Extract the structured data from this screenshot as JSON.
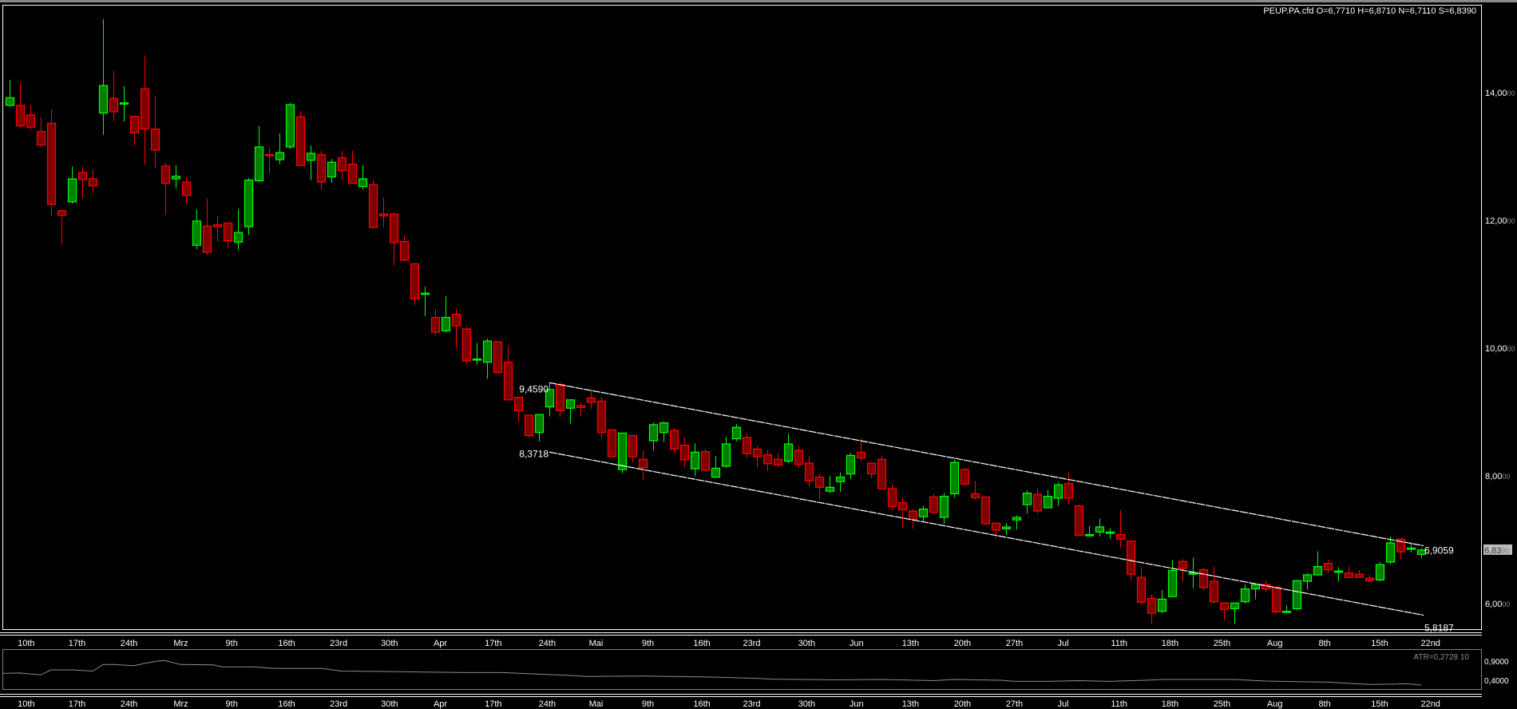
{
  "header": {
    "text": "PEUP.PA.cfd O=6,7710 H=6,8710 N=6,7110 S=6,8390"
  },
  "colors": {
    "background": "#000000",
    "bull_fill": "#008000",
    "bull_stroke": "#00ff00",
    "bear_fill": "#800000",
    "bear_stroke": "#ff0000",
    "channel": "#ffffff",
    "atr_line": "#8c8c8c"
  },
  "chart_data": {
    "type": "candlestick",
    "symbol": "PEUP.PA.cfd",
    "ylim": [
      5.64,
      15.33
    ],
    "y_ticks": [
      {
        "value": 14,
        "major": "14,00",
        "minor": "00"
      },
      {
        "value": 12,
        "major": "12,00",
        "minor": "00"
      },
      {
        "value": 10,
        "major": "10,00",
        "minor": "00"
      },
      {
        "value": 8,
        "major": "8,00",
        "minor": "00"
      },
      {
        "value": 6,
        "major": "6,00",
        "minor": "00"
      }
    ],
    "last_price": {
      "value": 6.839,
      "major": "6,83",
      "minor": "90"
    },
    "x_labels": [
      {
        "pos": 2.6,
        "text": "10th"
      },
      {
        "pos": 7.5,
        "text": "17th"
      },
      {
        "pos": 12.5,
        "text": "24th"
      },
      {
        "pos": 17.5,
        "text": "Mrz"
      },
      {
        "pos": 22.4,
        "text": "9th"
      },
      {
        "pos": 27.7,
        "text": "16th"
      },
      {
        "pos": 32.7,
        "text": "23rd"
      },
      {
        "pos": 37.6,
        "text": "30th"
      },
      {
        "pos": 42.5,
        "text": "Apr"
      },
      {
        "pos": 47.6,
        "text": "17th"
      },
      {
        "pos": 52.8,
        "text": "24th"
      },
      {
        "pos": 57.5,
        "text": "Mai"
      },
      {
        "pos": 62.5,
        "text": "9th"
      },
      {
        "pos": 67.7,
        "text": "16th"
      },
      {
        "pos": 72.5,
        "text": "23rd"
      },
      {
        "pos": 77.8,
        "text": "30th"
      },
      {
        "pos": 82.6,
        "text": "Jun"
      },
      {
        "pos": 87.8,
        "text": "13th"
      },
      {
        "pos": 92.8,
        "text": "20th"
      },
      {
        "pos": 97.8,
        "text": "27th"
      },
      {
        "pos": 102.5,
        "text": "Jul"
      },
      {
        "pos": 107.9,
        "text": "11th"
      },
      {
        "pos": 112.8,
        "text": "18th"
      },
      {
        "pos": 117.8,
        "text": "25th"
      },
      {
        "pos": 122.9,
        "text": "Aug"
      },
      {
        "pos": 127.7,
        "text": "8th"
      },
      {
        "pos": 133.0,
        "text": "15th"
      },
      {
        "pos": 137.9,
        "text": "22nd"
      }
    ],
    "ohlc": [
      [
        13.8,
        14.2,
        13.78,
        13.92
      ],
      [
        13.8,
        14.15,
        13.44,
        13.48
      ],
      [
        13.65,
        13.81,
        13.42,
        13.46
      ],
      [
        13.39,
        13.62,
        13.15,
        13.18
      ],
      [
        13.52,
        13.73,
        12.07,
        12.25
      ],
      [
        12.15,
        12.17,
        11.62,
        12.08
      ],
      [
        12.29,
        12.84,
        12.26,
        12.65
      ],
      [
        12.75,
        12.84,
        12.34,
        12.64
      ],
      [
        12.65,
        12.8,
        12.43,
        12.54
      ],
      [
        13.68,
        15.15,
        13.34,
        14.11
      ],
      [
        13.91,
        14.34,
        13.55,
        13.7
      ],
      [
        13.82,
        14.1,
        13.55,
        13.84
      ],
      [
        13.63,
        13.63,
        13.17,
        13.37
      ],
      [
        14.06,
        14.58,
        12.87,
        13.43
      ],
      [
        13.43,
        13.95,
        12.82,
        13.1
      ],
      [
        12.85,
        12.9,
        12.09,
        12.58
      ],
      [
        12.65,
        12.86,
        12.5,
        12.69
      ],
      [
        12.6,
        12.68,
        12.25,
        12.39
      ],
      [
        11.61,
        12.17,
        11.55,
        11.99
      ],
      [
        11.91,
        12.34,
        11.46,
        11.5
      ],
      [
        11.93,
        12.07,
        11.67,
        11.9
      ],
      [
        11.96,
        11.96,
        11.57,
        11.68
      ],
      [
        11.66,
        12.17,
        11.54,
        11.81
      ],
      [
        11.9,
        12.66,
        11.77,
        12.63
      ],
      [
        12.62,
        13.48,
        12.6,
        13.15
      ],
      [
        13.03,
        13.14,
        12.73,
        13.01
      ],
      [
        12.95,
        13.36,
        12.88,
        13.06
      ],
      [
        13.15,
        13.84,
        13.12,
        13.81
      ],
      [
        13.62,
        13.71,
        12.86,
        12.86
      ],
      [
        12.94,
        13.17,
        12.63,
        13.05
      ],
      [
        13.03,
        13.09,
        12.48,
        12.6
      ],
      [
        12.68,
        12.96,
        12.59,
        12.91
      ],
      [
        12.98,
        13.09,
        12.64,
        12.78
      ],
      [
        12.88,
        13.09,
        12.57,
        12.58
      ],
      [
        12.53,
        12.87,
        12.48,
        12.65
      ],
      [
        12.56,
        12.63,
        11.87,
        11.89
      ],
      [
        12.1,
        12.36,
        11.89,
        12.07
      ],
      [
        12.1,
        12.13,
        11.29,
        11.65
      ],
      [
        11.67,
        11.76,
        11.36,
        11.38
      ],
      [
        11.32,
        11.32,
        10.67,
        10.77
      ],
      [
        10.85,
        10.96,
        10.5,
        10.86
      ],
      [
        10.48,
        10.6,
        10.2,
        10.25
      ],
      [
        10.27,
        10.81,
        10.24,
        10.48
      ],
      [
        10.53,
        10.61,
        10.0,
        10.35
      ],
      [
        10.3,
        10.34,
        9.74,
        9.8
      ],
      [
        9.82,
        10.08,
        9.74,
        9.83
      ],
      [
        9.78,
        10.15,
        9.52,
        10.11
      ],
      [
        10.1,
        10.1,
        9.6,
        9.62
      ],
      [
        9.78,
        10.05,
        9.19,
        9.19
      ],
      [
        9.23,
        9.23,
        8.84,
        9.02
      ],
      [
        8.95,
        8.96,
        8.6,
        8.63
      ],
      [
        8.68,
        8.96,
        8.54,
        8.96
      ],
      [
        9.08,
        9.45,
        8.93,
        9.35
      ],
      [
        9.43,
        9.46,
        8.92,
        9.02
      ],
      [
        9.06,
        9.2,
        8.82,
        9.19
      ],
      [
        9.1,
        9.15,
        8.93,
        9.07
      ],
      [
        9.22,
        9.33,
        9.05,
        9.15
      ],
      [
        9.17,
        9.23,
        8.59,
        8.68
      ],
      [
        8.72,
        8.73,
        8.29,
        8.3
      ],
      [
        8.1,
        8.67,
        8.04,
        8.67
      ],
      [
        8.63,
        8.63,
        8.21,
        8.3
      ],
      [
        8.26,
        8.4,
        7.94,
        8.13
      ],
      [
        8.55,
        8.83,
        8.4,
        8.8
      ],
      [
        8.68,
        8.85,
        8.53,
        8.83
      ],
      [
        8.71,
        8.75,
        8.35,
        8.42
      ],
      [
        8.48,
        8.6,
        8.13,
        8.25
      ],
      [
        8.11,
        8.51,
        8.0,
        8.37
      ],
      [
        8.38,
        8.42,
        8.07,
        8.09
      ],
      [
        7.98,
        8.31,
        7.97,
        8.12
      ],
      [
        8.15,
        8.61,
        8.13,
        8.5
      ],
      [
        8.58,
        8.81,
        8.54,
        8.76
      ],
      [
        8.6,
        8.67,
        8.28,
        8.35
      ],
      [
        8.42,
        8.47,
        8.14,
        8.3
      ],
      [
        8.33,
        8.41,
        8.08,
        8.19
      ],
      [
        8.26,
        8.36,
        8.14,
        8.17
      ],
      [
        8.23,
        8.66,
        8.2,
        8.5
      ],
      [
        8.4,
        8.46,
        8.12,
        8.18
      ],
      [
        8.2,
        8.31,
        7.84,
        7.92
      ],
      [
        7.98,
        8.04,
        7.62,
        7.82
      ],
      [
        7.76,
        8.0,
        7.73,
        7.82
      ],
      [
        7.91,
        8.05,
        7.75,
        7.98
      ],
      [
        8.03,
        8.36,
        7.95,
        8.32
      ],
      [
        8.37,
        8.58,
        8.24,
        8.28
      ],
      [
        8.2,
        8.2,
        7.96,
        8.03
      ],
      [
        8.26,
        8.32,
        7.8,
        7.8
      ],
      [
        7.8,
        7.88,
        7.46,
        7.52
      ],
      [
        7.58,
        7.67,
        7.19,
        7.47
      ],
      [
        7.45,
        7.48,
        7.17,
        7.32
      ],
      [
        7.36,
        7.53,
        7.29,
        7.48
      ],
      [
        7.67,
        7.72,
        7.41,
        7.43
      ],
      [
        7.35,
        7.73,
        7.25,
        7.68
      ],
      [
        7.72,
        8.26,
        7.66,
        8.21
      ],
      [
        8.1,
        8.12,
        7.85,
        7.87
      ],
      [
        7.72,
        7.92,
        7.63,
        7.66
      ],
      [
        7.67,
        7.67,
        7.22,
        7.25
      ],
      [
        7.26,
        7.26,
        7.03,
        7.15
      ],
      [
        7.17,
        7.26,
        7.07,
        7.2
      ],
      [
        7.31,
        7.38,
        7.16,
        7.35
      ],
      [
        7.55,
        7.77,
        7.41,
        7.73
      ],
      [
        7.71,
        7.8,
        7.41,
        7.45
      ],
      [
        7.5,
        7.78,
        7.5,
        7.68
      ],
      [
        7.65,
        7.9,
        7.53,
        7.86
      ],
      [
        7.88,
        8.05,
        7.56,
        7.65
      ],
      [
        7.53,
        7.55,
        7.06,
        7.07
      ],
      [
        7.07,
        7.22,
        7.05,
        7.08
      ],
      [
        7.12,
        7.33,
        7.05,
        7.2
      ],
      [
        7.1,
        7.18,
        7.02,
        7.12
      ],
      [
        7.08,
        7.46,
        6.88,
        7.01
      ],
      [
        6.98,
        6.99,
        6.36,
        6.46
      ],
      [
        6.41,
        6.57,
        5.98,
        6.02
      ],
      [
        6.08,
        6.15,
        5.68,
        5.85
      ],
      [
        5.88,
        6.21,
        5.85,
        6.07
      ],
      [
        6.11,
        6.68,
        6.1,
        6.52
      ],
      [
        6.66,
        6.7,
        6.35,
        6.55
      ],
      [
        6.46,
        6.72,
        6.24,
        6.48
      ],
      [
        6.53,
        6.56,
        6.21,
        6.25
      ],
      [
        6.35,
        6.58,
        6.0,
        6.03
      ],
      [
        6.01,
        6.02,
        5.74,
        5.91
      ],
      [
        5.92,
        6.01,
        5.68,
        6.01
      ],
      [
        6.03,
        6.3,
        6.0,
        6.23
      ],
      [
        6.23,
        6.31,
        6.07,
        6.3
      ],
      [
        6.3,
        6.37,
        6.18,
        6.23
      ],
      [
        6.26,
        6.27,
        5.85,
        5.87
      ],
      [
        5.87,
        5.97,
        5.86,
        5.88
      ],
      [
        5.92,
        6.37,
        5.9,
        6.36
      ],
      [
        6.35,
        6.48,
        6.22,
        6.45
      ],
      [
        6.45,
        6.82,
        6.45,
        6.58
      ],
      [
        6.63,
        6.68,
        6.48,
        6.53
      ],
      [
        6.49,
        6.57,
        6.35,
        6.51
      ],
      [
        6.48,
        6.58,
        6.4,
        6.41
      ],
      [
        6.46,
        6.53,
        6.41,
        6.41
      ],
      [
        6.4,
        6.45,
        6.35,
        6.36
      ],
      [
        6.37,
        6.65,
        6.35,
        6.61
      ],
      [
        6.65,
        7.05,
        6.62,
        6.95
      ],
      [
        7.01,
        7.02,
        6.7,
        6.81
      ],
      [
        6.85,
        6.96,
        6.8,
        6.87
      ],
      [
        6.771,
        6.871,
        6.711,
        6.839
      ]
    ],
    "channel": {
      "start_index": 53,
      "end_index": 137,
      "upper": [
        9.459,
        6.9059
      ],
      "lower": [
        8.3718,
        5.8187
      ],
      "labels": {
        "upper_start": "9,4590",
        "lower_start": "8,3718",
        "upper_end": "6,9059",
        "lower_end": "5,8187"
      }
    },
    "atr": {
      "label": "ATR=0,2728  10",
      "period": 10,
      "ylim": [
        0.1,
        1.05
      ],
      "y_ticks": [
        {
          "value": 0.9,
          "text": "0,9000"
        },
        {
          "value": 0.4,
          "text": "0,4000"
        }
      ],
      "points": [
        [
          0.3,
          0.58
        ],
        [
          2,
          0.59
        ],
        [
          4,
          0.54
        ],
        [
          5,
          0.67
        ],
        [
          7,
          0.67
        ],
        [
          9,
          0.64
        ],
        [
          10,
          0.81
        ],
        [
          11,
          0.81
        ],
        [
          13,
          0.78
        ],
        [
          14,
          0.84
        ],
        [
          15.5,
          0.91
        ],
        [
          16,
          0.91
        ],
        [
          17.5,
          0.81
        ],
        [
          20.6,
          0.8
        ],
        [
          21.5,
          0.75
        ],
        [
          24.5,
          0.75
        ],
        [
          26.4,
          0.71
        ],
        [
          31,
          0.71
        ],
        [
          33,
          0.64
        ],
        [
          37,
          0.63
        ],
        [
          44.8,
          0.6
        ],
        [
          48.5,
          0.6
        ],
        [
          51.8,
          0.56
        ],
        [
          54.6,
          0.53
        ],
        [
          56.7,
          0.5
        ],
        [
          62,
          0.51
        ],
        [
          67.7,
          0.49
        ],
        [
          70.5,
          0.47
        ],
        [
          73,
          0.45
        ],
        [
          74.5,
          0.43
        ],
        [
          80.6,
          0.41
        ],
        [
          85,
          0.42
        ],
        [
          90,
          0.39
        ],
        [
          92,
          0.42
        ],
        [
          96.5,
          0.4
        ],
        [
          97.8,
          0.37
        ],
        [
          101,
          0.37
        ],
        [
          104,
          0.39
        ],
        [
          107,
          0.37
        ],
        [
          110.5,
          0.4
        ],
        [
          112,
          0.42
        ],
        [
          119,
          0.42
        ],
        [
          122,
          0.38
        ],
        [
          128,
          0.35
        ],
        [
          132,
          0.29
        ],
        [
          134.7,
          0.3
        ],
        [
          135.6,
          0.31
        ],
        [
          137,
          0.2728
        ]
      ]
    }
  }
}
